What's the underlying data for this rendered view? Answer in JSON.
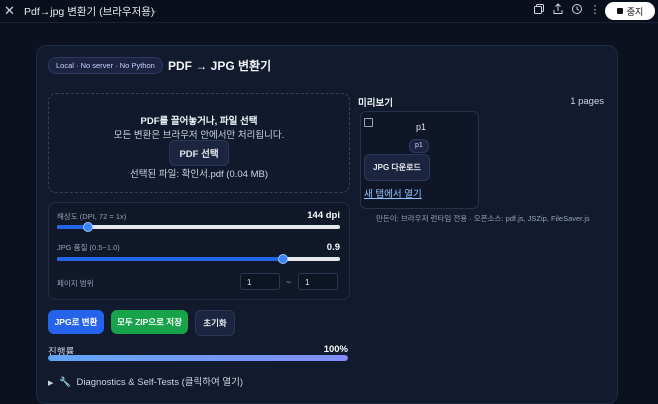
{
  "window": {
    "title": "Pdf→jpg 변환기 (브라우저용)",
    "stop_label": "중지"
  },
  "card": {
    "chip": "Local · No server · No Python",
    "title": "PDF → JPG 변환기"
  },
  "dropzone": {
    "title": "PDF를 끌어놓거나, 파일 선택",
    "subtitle": "모든 변환은 브라우저 안에서만 처리됩니다.",
    "button": "PDF 선택",
    "selected_file": "선택된 파일: 확인서.pdf (0.04 MB)"
  },
  "settings": {
    "resolution": {
      "label": "해상도 (DPI, 72 = 1x)",
      "value": "144 dpi",
      "fraction": 0.11
    },
    "quality": {
      "label": "JPG 품질 (0.5~1.0)",
      "value": "0.9",
      "fraction": 0.8
    },
    "page_range": {
      "label": "페이지 범위",
      "from": "1",
      "sep": "~",
      "to": "1"
    }
  },
  "actions": {
    "convert": "JPG로 변환",
    "zip": "모두 ZIP으로 저장",
    "reset": "초기화"
  },
  "progress": {
    "label": "진행률",
    "percent_text": "100%",
    "percent": 100
  },
  "diagnostics": {
    "arrow": "▶",
    "text": "Diagnostics & Self-Tests (클릭하여 열기)"
  },
  "preview": {
    "title": "미리보기",
    "pages": "1 pages",
    "img_alt": "p1",
    "badge": "p1",
    "download": "JPG 다운로드",
    "open_tab": "새 탭에서 열기",
    "credit": "만든이: 브라우저 런타임 전용 · 오픈소스: pdf.js, JSZip, FileSaver.js"
  },
  "colors": {
    "accent": "#2563eb",
    "success": "#16a34a",
    "background": "#0c1120",
    "card": "#121a2e"
  }
}
